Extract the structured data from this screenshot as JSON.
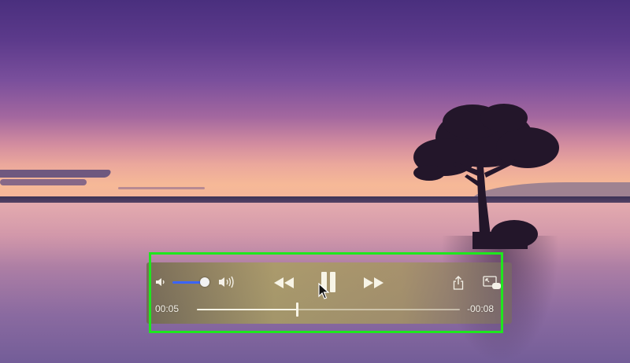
{
  "player": {
    "current_time": "00:05",
    "remaining_time": "-00:08",
    "playback_progress": 0.38,
    "volume_level": 0.9,
    "state": "playing"
  },
  "controls": {
    "volume_low_icon": "speaker-low-icon",
    "volume_high_icon": "speaker-high-icon",
    "rewind_icon": "rewind-icon",
    "pause_icon": "pause-icon",
    "forward_icon": "fast-forward-icon",
    "share_icon": "share-icon",
    "pip_icon": "picture-in-picture-icon"
  },
  "colors": {
    "highlight": "#1ee71e",
    "volume_accent": "#3a64ff"
  }
}
